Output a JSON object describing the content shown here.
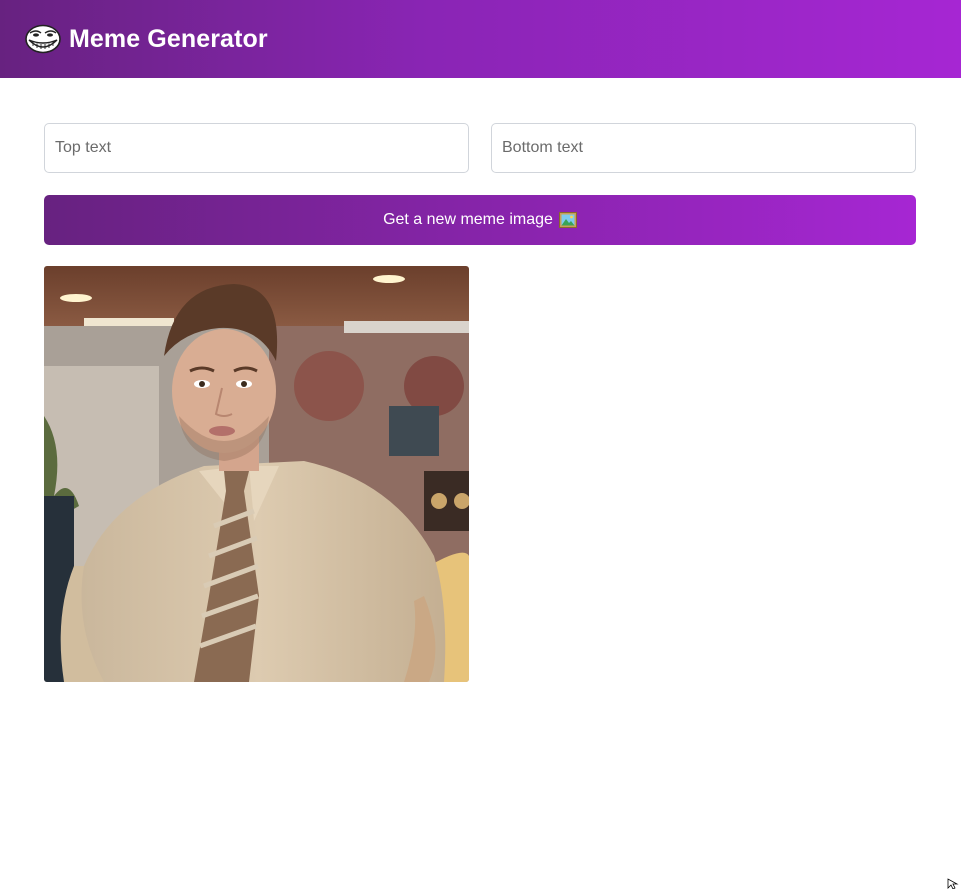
{
  "header": {
    "logo_icon": "troll-face-icon",
    "title": "Meme Generator",
    "gradient": [
      "#672280",
      "#A626D3"
    ]
  },
  "form": {
    "top_text": {
      "value": "",
      "placeholder": "Top text"
    },
    "bottom_text": {
      "value": "",
      "placeholder": "Bottom text"
    },
    "button_label": "Get a new meme image",
    "button_icon": "framed-picture-icon"
  },
  "meme": {
    "image_name": "meme-image"
  }
}
